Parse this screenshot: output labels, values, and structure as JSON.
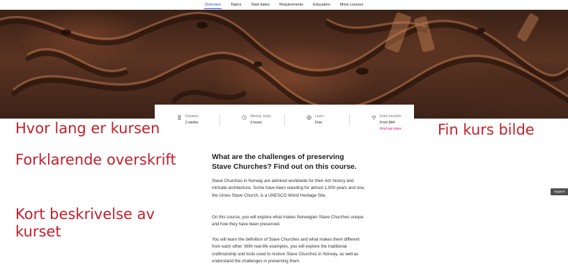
{
  "nav": {
    "items": [
      {
        "label": "Overview"
      },
      {
        "label": "Topics"
      },
      {
        "label": "Start dates"
      },
      {
        "label": "Requirements"
      },
      {
        "label": "Educators"
      },
      {
        "label": "More courses"
      }
    ]
  },
  "hero": {
    "icon": "carved-wood-image"
  },
  "stats": {
    "duration": {
      "label": "Duration",
      "value": "2 weeks",
      "icon": "hourglass-icon"
    },
    "weekly": {
      "label": "Weekly study",
      "value": "3 hours",
      "icon": "clock-icon"
    },
    "learn": {
      "label": "Learn",
      "value": "Free",
      "icon": "globe-icon"
    },
    "extra": {
      "label": "Extra benefits",
      "value": "From $44",
      "link": "Find out more",
      "icon": "diamond-icon"
    },
    "link_color": "#d6007a"
  },
  "annotations": {
    "duration_note": "Hvor lang er kursen",
    "image_note": "Fin kurs bilde",
    "heading_note": "Forklarende overskrift",
    "desc_note_line1": "Kort beskrivelse av",
    "desc_note_line2": "kurset",
    "color": "#c4202a"
  },
  "content": {
    "heading": "What are the challenges of preserving Stave Churches? Find out on this course.",
    "p1": "Stave Churches in Norway are admired worldwide for their rich history and intricate architecture. Some have been standing for almost 1,000 years and one, the Urnes Stave Church, is a UNESCO World Heritage Site.",
    "p2": "On this course, you will explore what makes Norwegian Stave Churches unique and how they have been preserved.",
    "p3": "You will learn the definition of Stave Churches and what makes them different from each other. With real-life examples, you will explore the traditional craftmanship and tools used to restore Stave Churches in Norway, as well as understand the challenges in preserving them."
  },
  "support": {
    "label": "Support"
  }
}
